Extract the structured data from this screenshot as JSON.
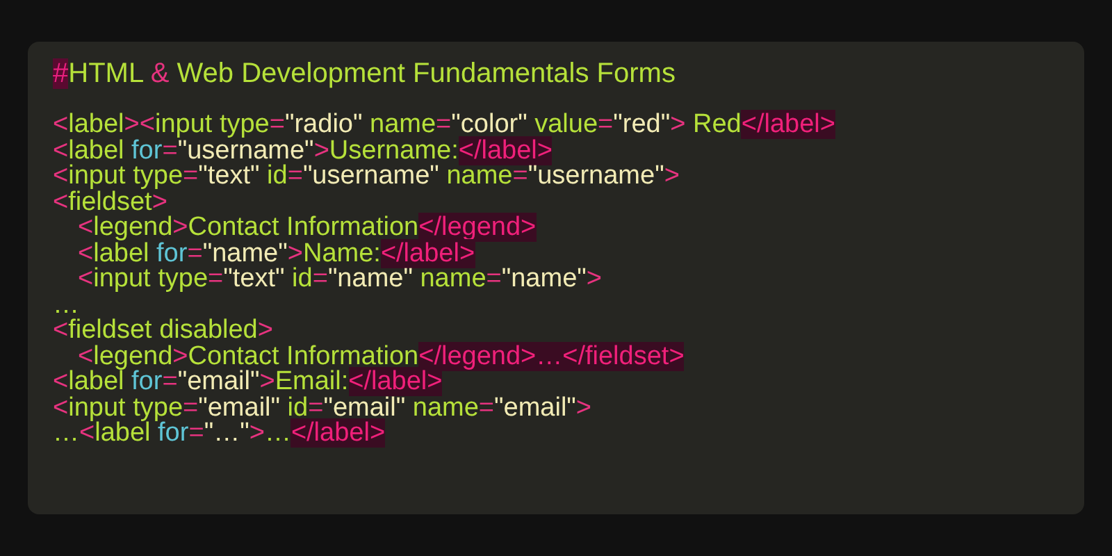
{
  "title": [
    {
      "kind": "hash",
      "text": "#"
    },
    {
      "kind": "text",
      "text": "HTML "
    },
    {
      "kind": "punct",
      "text": "&"
    },
    {
      "kind": "text",
      "text": " Web Development Fundamentals Forms"
    }
  ],
  "lines": [
    {
      "tokens": [
        {
          "kind": "punct",
          "text": "<"
        },
        {
          "kind": "tag",
          "text": "label"
        },
        {
          "kind": "punct",
          "text": "><"
        },
        {
          "kind": "tag",
          "text": "input "
        },
        {
          "kind": "attr",
          "text": "type"
        },
        {
          "kind": "punct",
          "text": "="
        },
        {
          "kind": "string",
          "text": "\"radio\" "
        },
        {
          "kind": "attr",
          "text": "name"
        },
        {
          "kind": "punct",
          "text": "="
        },
        {
          "kind": "string",
          "text": "\"color\" "
        },
        {
          "kind": "attr",
          "text": "value"
        },
        {
          "kind": "punct",
          "text": "="
        },
        {
          "kind": "string",
          "text": "\"red\""
        },
        {
          "kind": "punct",
          "text": ">"
        },
        {
          "kind": "text",
          "text": " Red"
        },
        {
          "kind": "close",
          "text": "</label>"
        }
      ]
    },
    {
      "tokens": [
        {
          "kind": "punct",
          "text": "<"
        },
        {
          "kind": "tag",
          "text": "label "
        },
        {
          "kind": "keyword",
          "text": "for"
        },
        {
          "kind": "punct",
          "text": "="
        },
        {
          "kind": "string",
          "text": "\"username\""
        },
        {
          "kind": "punct",
          "text": ">"
        },
        {
          "kind": "text",
          "text": "Username:"
        },
        {
          "kind": "close",
          "text": "</label>"
        }
      ]
    },
    {
      "tokens": [
        {
          "kind": "punct",
          "text": "<"
        },
        {
          "kind": "tag",
          "text": "input "
        },
        {
          "kind": "attr",
          "text": "type"
        },
        {
          "kind": "punct",
          "text": "="
        },
        {
          "kind": "string",
          "text": "\"text\" "
        },
        {
          "kind": "attr",
          "text": "id"
        },
        {
          "kind": "punct",
          "text": "="
        },
        {
          "kind": "string",
          "text": "\"username\" "
        },
        {
          "kind": "attr",
          "text": "name"
        },
        {
          "kind": "punct",
          "text": "="
        },
        {
          "kind": "string",
          "text": "\"username\""
        },
        {
          "kind": "punct",
          "text": ">"
        }
      ]
    },
    {
      "tokens": [
        {
          "kind": "punct",
          "text": "<"
        },
        {
          "kind": "tag",
          "text": "fieldset"
        },
        {
          "kind": "punct",
          "text": ">"
        }
      ],
      "children": [
        {
          "tokens": [
            {
              "kind": "punct",
              "text": "<"
            },
            {
              "kind": "tag",
              "text": "legend"
            },
            {
              "kind": "punct",
              "text": ">"
            },
            {
              "kind": "text",
              "text": "Contact Information"
            },
            {
              "kind": "close",
              "text": "</legend>"
            }
          ]
        },
        {
          "tokens": [
            {
              "kind": "punct",
              "text": "<"
            },
            {
              "kind": "tag",
              "text": "label "
            },
            {
              "kind": "keyword",
              "text": "for"
            },
            {
              "kind": "punct",
              "text": "="
            },
            {
              "kind": "string",
              "text": "\"name\""
            },
            {
              "kind": "punct",
              "text": ">"
            },
            {
              "kind": "text",
              "text": "Name:"
            },
            {
              "kind": "close",
              "text": "</label>"
            }
          ]
        },
        {
          "tokens": [
            {
              "kind": "punct",
              "text": "<"
            },
            {
              "kind": "tag",
              "text": "input "
            },
            {
              "kind": "attr",
              "text": "type"
            },
            {
              "kind": "punct",
              "text": "="
            },
            {
              "kind": "string",
              "text": "\"text\" "
            },
            {
              "kind": "attr",
              "text": "id"
            },
            {
              "kind": "punct",
              "text": "="
            },
            {
              "kind": "string",
              "text": "\"name\" "
            },
            {
              "kind": "attr",
              "text": "name"
            },
            {
              "kind": "punct",
              "text": "="
            },
            {
              "kind": "string",
              "text": "\"name\""
            },
            {
              "kind": "punct",
              "text": ">"
            }
          ]
        }
      ]
    },
    {
      "tokens": [
        {
          "kind": "text",
          "text": "…"
        }
      ]
    },
    {
      "tokens": [
        {
          "kind": "punct",
          "text": "<"
        },
        {
          "kind": "tag",
          "text": "fieldset disabled"
        },
        {
          "kind": "punct",
          "text": ">"
        }
      ],
      "children": [
        {
          "tokens": [
            {
              "kind": "punct",
              "text": "<"
            },
            {
              "kind": "tag",
              "text": "legend"
            },
            {
              "kind": "punct",
              "text": ">"
            },
            {
              "kind": "text",
              "text": "Contact Information"
            },
            {
              "kind": "close",
              "text": "</legend>…</fieldset>"
            }
          ]
        }
      ]
    },
    {
      "tokens": [
        {
          "kind": "punct",
          "text": "<"
        },
        {
          "kind": "tag",
          "text": "label "
        },
        {
          "kind": "keyword",
          "text": "for"
        },
        {
          "kind": "punct",
          "text": "="
        },
        {
          "kind": "string",
          "text": "\"email\""
        },
        {
          "kind": "punct",
          "text": ">"
        },
        {
          "kind": "text",
          "text": "Email:"
        },
        {
          "kind": "close",
          "text": "</label>"
        }
      ]
    },
    {
      "tokens": [
        {
          "kind": "punct",
          "text": "<"
        },
        {
          "kind": "tag",
          "text": "input "
        },
        {
          "kind": "attr",
          "text": "type"
        },
        {
          "kind": "punct",
          "text": "="
        },
        {
          "kind": "string",
          "text": "\"email\" "
        },
        {
          "kind": "attr",
          "text": "id"
        },
        {
          "kind": "punct",
          "text": "="
        },
        {
          "kind": "string",
          "text": "\"email\" "
        },
        {
          "kind": "attr",
          "text": "name"
        },
        {
          "kind": "punct",
          "text": "="
        },
        {
          "kind": "string",
          "text": "\"email\""
        },
        {
          "kind": "punct",
          "text": ">"
        }
      ]
    },
    {
      "tokens": [
        {
          "kind": "text",
          "text": "…"
        },
        {
          "kind": "punct",
          "text": "<"
        },
        {
          "kind": "tag",
          "text": "label "
        },
        {
          "kind": "keyword",
          "text": "for"
        },
        {
          "kind": "punct",
          "text": "="
        },
        {
          "kind": "string",
          "text": "\"…\""
        },
        {
          "kind": "punct",
          "text": ">"
        },
        {
          "kind": "text",
          "text": "…"
        },
        {
          "kind": "close",
          "text": "</label>"
        }
      ]
    }
  ]
}
